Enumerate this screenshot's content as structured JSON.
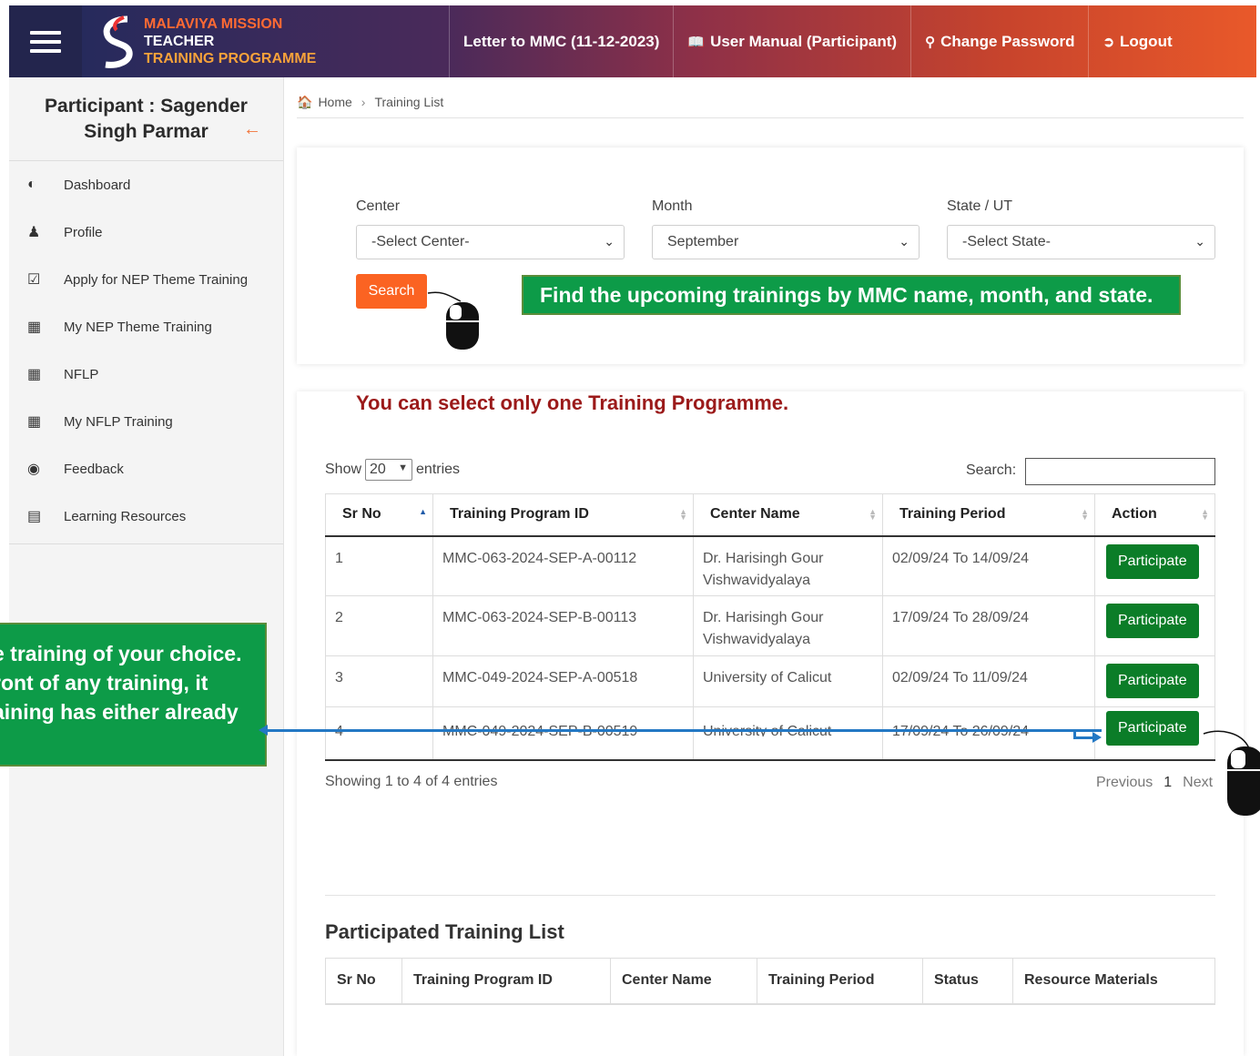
{
  "header": {
    "brand_line1": "MALAVIYA MISSION",
    "brand_line2": "TEACHER",
    "brand_line3": "TRAINING PROGRAMME",
    "links": [
      {
        "label": "Letter to MMC (11-12-2023)",
        "icon": ""
      },
      {
        "label": "User Manual (Participant)",
        "icon": "book-icon"
      },
      {
        "label": "Change Password",
        "icon": "key-icon"
      },
      {
        "label": "Logout",
        "icon": "logout-icon"
      }
    ]
  },
  "sidebar": {
    "title": "Participant : Sagender Singh Parmar",
    "items": [
      {
        "label": "Dashboard",
        "icon": "dashboard-icon"
      },
      {
        "label": "Profile",
        "icon": "user-icon"
      },
      {
        "label": "Apply for NEP Theme Training",
        "icon": "calendar-check-icon"
      },
      {
        "label": "My NEP Theme Training",
        "icon": "grid-icon"
      },
      {
        "label": "NFLP",
        "icon": "calendar-icon"
      },
      {
        "label": "My NFLP Training",
        "icon": "grid-icon"
      },
      {
        "label": "Feedback",
        "icon": "comment-icon"
      },
      {
        "label": "Learning Resources",
        "icon": "book-open-icon"
      }
    ]
  },
  "breadcrumb": {
    "home": "Home",
    "current": "Training List"
  },
  "filters": {
    "center_label": "Center",
    "center_value": "-Select Center-",
    "month_label": "Month",
    "month_value": "September",
    "state_label": "State / UT",
    "state_value": "-Select State-",
    "search_button": "Search"
  },
  "callout_top": "Find the upcoming trainings by MMC name, month, and state.",
  "callout_left": [
    "e training of your choice.",
    "ront of any training, it",
    "aining has either already"
  ],
  "training_table": {
    "warning": "You can select only one Training Programme.",
    "show_label": "Show",
    "entries_value": "20",
    "entries_label": "entries",
    "search_label": "Search:",
    "search_value": "",
    "columns": [
      "Sr No",
      "Training Program ID",
      "Center Name",
      "Training Period",
      "Action"
    ],
    "rows": [
      {
        "sr": "1",
        "id": "MMC-063-2024-SEP-A-00112",
        "center": "Dr. Harisingh Gour Vishwavidyalaya",
        "period": "02/09/24 To 14/09/24",
        "action": "Participate"
      },
      {
        "sr": "2",
        "id": "MMC-063-2024-SEP-B-00113",
        "center": "Dr. Harisingh Gour Vishwavidyalaya",
        "period": "17/09/24 To 28/09/24",
        "action": "Participate"
      },
      {
        "sr": "3",
        "id": "MMC-049-2024-SEP-A-00518",
        "center": "University of Calicut",
        "period": "02/09/24 To 11/09/24",
        "action": "Participate"
      },
      {
        "sr": "4",
        "id": "MMC-049-2024-SEP-B-00519",
        "center": "University of Calicut",
        "period": "17/09/24 To 26/09/24",
        "action": "Participate"
      }
    ],
    "info": "Showing 1 to 4 of 4 entries",
    "prev": "Previous",
    "page": "1",
    "next": "Next"
  },
  "participated": {
    "title": "Participated Training List",
    "columns": [
      "Sr No",
      "Training Program ID",
      "Center Name",
      "Training Period",
      "Status",
      "Resource Materials"
    ]
  },
  "colors": {
    "callout_green": "#0d9b48",
    "search_orange": "#fb6322",
    "participate_green": "#0b7d28",
    "warning_red": "#9b1a1a",
    "arrow_blue": "#2378c4"
  }
}
